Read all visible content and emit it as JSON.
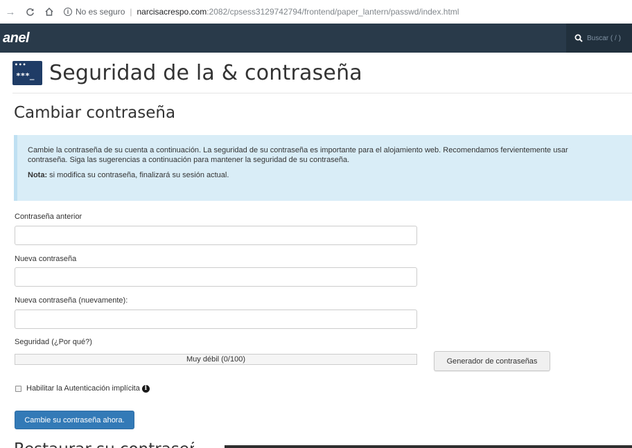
{
  "browser": {
    "back_icon": "arrow-right-icon",
    "security_label": "No es seguro",
    "url_host": "narcisacrespo.com",
    "url_path": ":2082/cpsess3129742794/frontend/paper_lantern/passwd/index.html"
  },
  "header": {
    "logo_text": "anel",
    "search_placeholder": "Buscar ( / )"
  },
  "page": {
    "title": "Seguridad de la & contraseña",
    "icon_dots": "•••",
    "icon_text": "***_",
    "section_heading": "Cambiar contraseña",
    "next_section_heading": "Restaurar su contraseña"
  },
  "info": {
    "line1": "Cambie la contraseña de su cuenta a continuación. La seguridad de su contraseña es importante para el alojamiento web. Recomendamos fervientemente usar",
    "line2": "contraseña. Siga las sugerencias a continuación para mantener la seguridad de su contraseña.",
    "note_label": "Nota:",
    "note_text": " si modifica su contraseña, finalizará su sesión actual."
  },
  "form": {
    "old_password_label": "Contraseña anterior",
    "old_password_value": "",
    "new_password_label": "Nueva contraseña",
    "new_password_value": "",
    "confirm_password_label": "Nueva contraseña (nuevamente):",
    "confirm_password_value": "",
    "strength_label": "Seguridad (¿Por qué?)",
    "strength_text": "Muy débil (0/100)",
    "strength_value": 0,
    "generator_button": "Generador de contraseñas",
    "digest_auth_label": "Habilitar la Autenticación implícita",
    "digest_auth_checked": false,
    "submit_button": "Cambie su contraseña ahora."
  },
  "colors": {
    "header_bg": "#293a4a",
    "info_bg": "#d9edf7",
    "primary": "#337ab7"
  }
}
